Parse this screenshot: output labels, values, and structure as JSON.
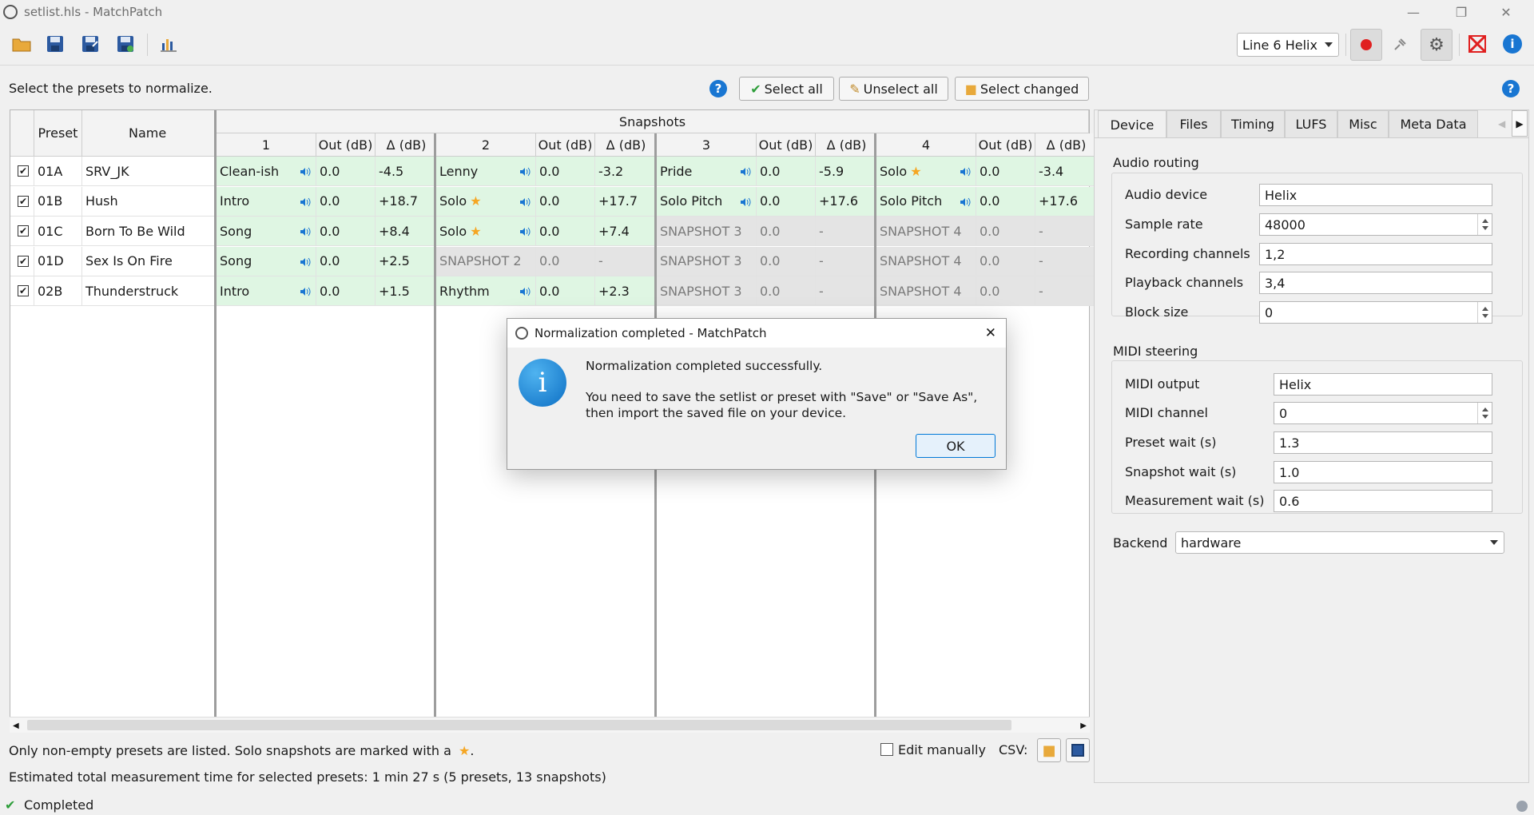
{
  "window": {
    "title": "setlist.hls - MatchPatch"
  },
  "toolbar": {
    "device_selected": "Line 6 Helix",
    "icons": [
      "open-folder-icon",
      "save-icon",
      "save-as-icon",
      "save-all-icon",
      "chart-icon",
      "record-icon",
      "pin-icon",
      "gear-icon",
      "fullscreen-icon",
      "info-icon"
    ]
  },
  "top": {
    "instruction": "Select the presets to normalize.",
    "select_all": "Select all",
    "unselect_all": "Unselect all",
    "select_changed": "Select changed"
  },
  "table": {
    "col_preset": "Preset",
    "col_name": "Name",
    "snapshots_header": "Snapshots",
    "snap_cols": [
      "1",
      "2",
      "3",
      "4"
    ],
    "out_label": "Out (dB)",
    "delta_label": "Δ (dB)",
    "rows": [
      {
        "preset": "01A",
        "name": "SRV_JK",
        "snaps": [
          {
            "name": "Clean-ish",
            "out": "0.0",
            "delta": "-4.5",
            "state": "green",
            "star": false,
            "spk": true
          },
          {
            "name": "Lenny",
            "out": "0.0",
            "delta": "-3.2",
            "state": "green",
            "star": false,
            "spk": true
          },
          {
            "name": "Pride",
            "out": "0.0",
            "delta": "-5.9",
            "state": "green",
            "star": false,
            "spk": true
          },
          {
            "name": "Solo",
            "out": "0.0",
            "delta": "-3.4",
            "state": "green",
            "star": true,
            "spk": true
          }
        ]
      },
      {
        "preset": "01B",
        "name": "Hush",
        "snaps": [
          {
            "name": "Intro",
            "out": "0.0",
            "delta": "+18.7",
            "state": "green",
            "star": false,
            "spk": true
          },
          {
            "name": "Solo",
            "out": "0.0",
            "delta": "+17.7",
            "state": "green",
            "star": true,
            "spk": true
          },
          {
            "name": "Solo Pitch",
            "out": "0.0",
            "delta": "+17.6",
            "state": "green",
            "star": false,
            "spk": true
          },
          {
            "name": "Solo Pitch",
            "out": "0.0",
            "delta": "+17.6",
            "state": "green",
            "star": false,
            "spk": true
          }
        ]
      },
      {
        "preset": "01C",
        "name": "Born To Be Wild",
        "snaps": [
          {
            "name": "Song",
            "out": "0.0",
            "delta": "+8.4",
            "state": "green",
            "star": false,
            "spk": true
          },
          {
            "name": "Solo",
            "out": "0.0",
            "delta": "+7.4",
            "state": "green",
            "star": true,
            "spk": true
          },
          {
            "name": "SNAPSHOT 3",
            "out": "0.0",
            "delta": "-",
            "state": "gray",
            "star": false,
            "spk": false
          },
          {
            "name": "SNAPSHOT 4",
            "out": "0.0",
            "delta": "-",
            "state": "gray",
            "star": false,
            "spk": false
          }
        ]
      },
      {
        "preset": "01D",
        "name": "Sex Is On Fire",
        "snaps": [
          {
            "name": "Song",
            "out": "0.0",
            "delta": "+2.5",
            "state": "green",
            "star": false,
            "spk": true
          },
          {
            "name": "SNAPSHOT 2",
            "out": "0.0",
            "delta": "-",
            "state": "gray",
            "star": false,
            "spk": false
          },
          {
            "name": "SNAPSHOT 3",
            "out": "0.0",
            "delta": "-",
            "state": "gray",
            "star": false,
            "spk": false
          },
          {
            "name": "SNAPSHOT 4",
            "out": "0.0",
            "delta": "-",
            "state": "gray",
            "star": false,
            "spk": false
          }
        ]
      },
      {
        "preset": "02B",
        "name": "Thunderstruck",
        "snaps": [
          {
            "name": "Intro",
            "out": "0.0",
            "delta": "+1.5",
            "state": "green",
            "star": false,
            "spk": true
          },
          {
            "name": "Rhythm",
            "out": "0.0",
            "delta": "+2.3",
            "state": "green",
            "star": false,
            "spk": true
          },
          {
            "name": "SNAPSHOT 3",
            "out": "0.0",
            "delta": "-",
            "state": "gray",
            "star": false,
            "spk": false
          },
          {
            "name": "SNAPSHOT 4",
            "out": "0.0",
            "delta": "-",
            "state": "gray",
            "star": false,
            "spk": false
          }
        ]
      }
    ]
  },
  "bottom": {
    "note_prefix": "Only non-empty presets are listed. Solo snapshots are marked with a",
    "note_star": "★",
    "note_suffix": ".",
    "edit_manually": "Edit manually",
    "csv_label": "CSV:",
    "estimate": "Estimated total measurement time for selected presets: 1 min 27 s (5 presets, 13 snapshots)",
    "status": "Completed"
  },
  "panel": {
    "tabs": [
      "Device",
      "Files",
      "Timing",
      "LUFS",
      "Misc",
      "Meta Data"
    ],
    "audio_routing": "Audio routing",
    "audio_device_label": "Audio device",
    "audio_device": "Helix",
    "sample_rate_label": "Sample rate",
    "sample_rate": "48000",
    "rec_channels_label": "Recording channels",
    "rec_channels": "1,2",
    "play_channels_label": "Playback channels",
    "play_channels": "3,4",
    "block_size_label": "Block size",
    "block_size": "0",
    "midi_steering": "MIDI steering",
    "midi_output_label": "MIDI output",
    "midi_output": "Helix",
    "midi_channel_label": "MIDI channel",
    "midi_channel": "0",
    "preset_wait_label": "Preset wait (s)",
    "preset_wait": "1.3",
    "snapshot_wait_label": "Snapshot wait (s)",
    "snapshot_wait": "1.0",
    "measurement_wait_label": "Measurement wait (s)",
    "measurement_wait": "0.6",
    "backend_label": "Backend",
    "backend": "hardware"
  },
  "dialog": {
    "title": "Normalization completed - MatchPatch",
    "line1": "Normalization completed successfully.",
    "line2": "You need to save the setlist or preset with \"Save\" or \"Save As\",",
    "line3": "then import the saved file on your device.",
    "ok": "OK"
  },
  "colors": {
    "accent": "#1976d2",
    "row_green": "#dff6e3",
    "row_gray": "#e4e4e4",
    "star": "#f5a623",
    "record": "#e02020"
  }
}
